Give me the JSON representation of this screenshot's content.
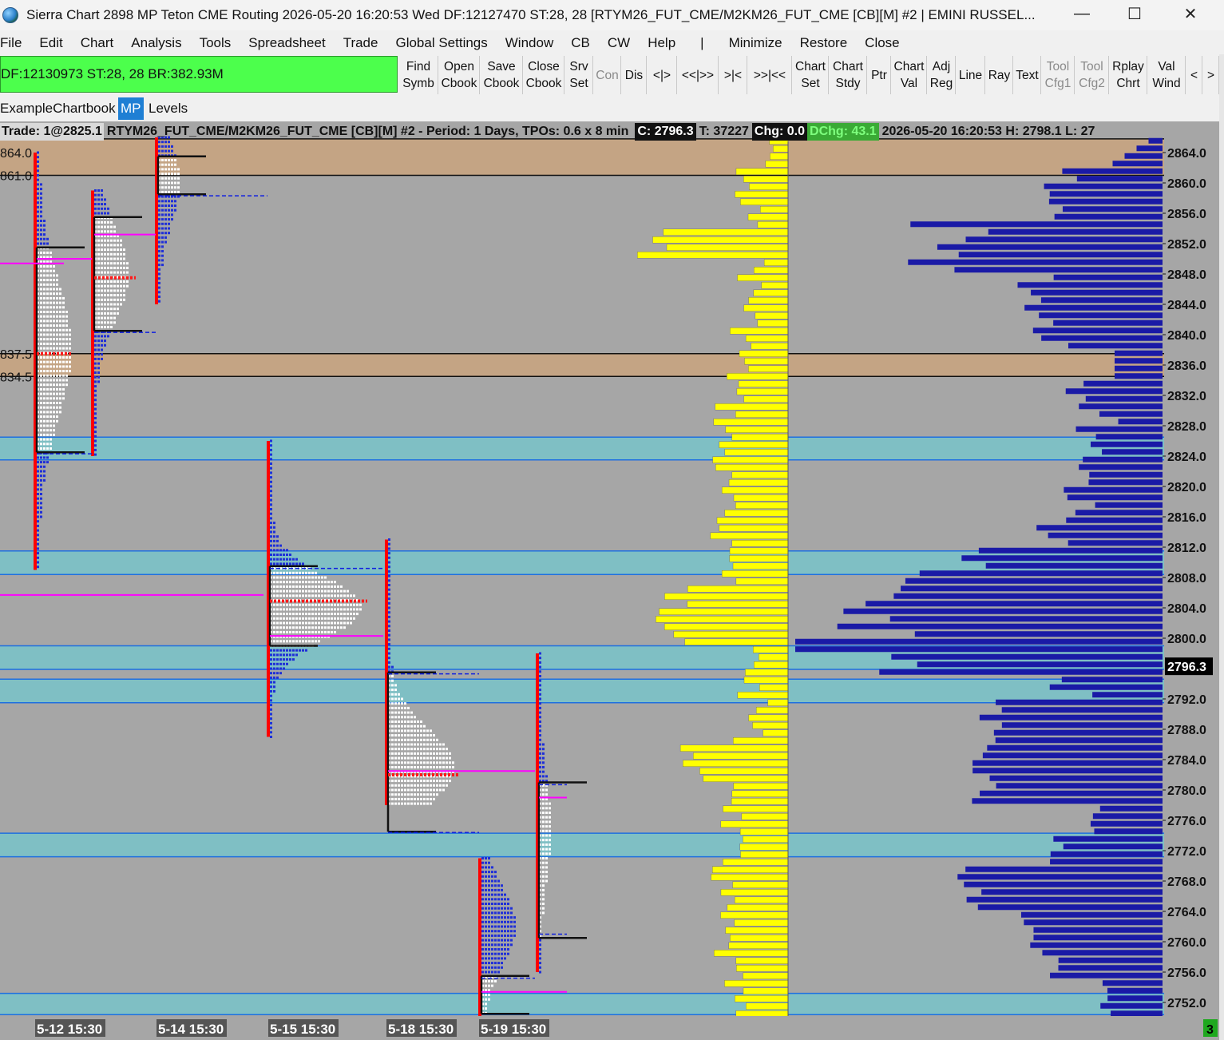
{
  "window": {
    "title": "Sierra Chart 2898 MP Teton CME Routing 2026-05-20  16:20:53 Wed DF:12127470  ST:28, 28 [RTYM26_FUT_CME/M2KM26_FUT_CME [CB][M] #2 | EMINI RUSSEL...",
    "minimize_glyph": "—",
    "maximize_glyph": "☐",
    "close_glyph": "✕"
  },
  "menu": [
    "File",
    "Edit",
    "Chart",
    "Analysis",
    "Tools",
    "Spreadsheet",
    "Trade",
    "Global Settings",
    "Window",
    "CB",
    "CW",
    "Help",
    "|",
    "Minimize",
    "Restore",
    "Close"
  ],
  "status_bar": "DF:12130973  ST:28, 28  BR:382.93M",
  "toolbar": [
    {
      "l1": "Find",
      "l2": "Symb",
      "dim": false
    },
    {
      "l1": "Open",
      "l2": "Cbook",
      "dim": false
    },
    {
      "l1": "Save",
      "l2": "Cbook",
      "dim": false
    },
    {
      "l1": "Close",
      "l2": "Cbook",
      "dim": false
    },
    {
      "l1": "Srv",
      "l2": "Set",
      "dim": false
    },
    {
      "l1": "Con",
      "l2": "",
      "dim": true
    },
    {
      "l1": "Dis",
      "l2": "",
      "dim": false
    },
    {
      "l1": "<|>",
      "l2": "",
      "dim": false
    },
    {
      "l1": "<<|>>",
      "l2": "",
      "dim": false
    },
    {
      "l1": ">|<",
      "l2": "",
      "dim": false
    },
    {
      "l1": ">>|<<",
      "l2": "",
      "dim": false
    },
    {
      "l1": "Chart",
      "l2": "Set",
      "dim": false
    },
    {
      "l1": "Chart",
      "l2": "Stdy",
      "dim": false
    },
    {
      "l1": "Ptr",
      "l2": "",
      "dim": false
    },
    {
      "l1": "Chart",
      "l2": "Val",
      "dim": false
    },
    {
      "l1": "Adj",
      "l2": "Reg",
      "dim": false
    },
    {
      "l1": "Line",
      "l2": "",
      "dim": false
    },
    {
      "l1": "Ray",
      "l2": "",
      "dim": false
    },
    {
      "l1": "Text",
      "l2": "",
      "dim": false
    },
    {
      "l1": "Tool",
      "l2": "Cfg1",
      "dim": true
    },
    {
      "l1": "Tool",
      "l2": "Cfg2",
      "dim": true
    },
    {
      "l1": "Rplay",
      "l2": "Chrt",
      "dim": false
    },
    {
      "l1": "Val",
      "l2": "Wind",
      "dim": false
    },
    {
      "l1": "<",
      "l2": "",
      "dim": false
    },
    {
      "l1": ">",
      "l2": "",
      "dim": false
    }
  ],
  "tabs": {
    "chartbook": "ExampleChartbook",
    "mp": "MP",
    "levels": "Levels"
  },
  "chart_header": {
    "trade": "Trade: 1@2825.1",
    "symbol": "RTYM26_FUT_CME/M2KM26_FUT_CME [CB][M] #2 - Period: 1 Days, TPOs: 0.6 x 8 min",
    "close": "C: 2796.3",
    "ticks": "T: 37227",
    "chg": "Chg: 0.0",
    "dchg": "DChg: 43.1",
    "datetime": "2026-05-20 16:20:53 H: 2798.1 L: 27"
  },
  "price_axis": [
    "2864.0",
    "2860.0",
    "2856.0",
    "2852.0",
    "2848.0",
    "2844.0",
    "2840.0",
    "2836.0",
    "2832.0",
    "2828.0",
    "2824.0",
    "2820.0",
    "2816.0",
    "2812.0",
    "2808.0",
    "2804.0",
    "2800.0",
    "2796.3",
    "2792.0",
    "2788.0",
    "2784.0",
    "2780.0",
    "2776.0",
    "2772.0",
    "2768.0",
    "2764.0",
    "2760.0",
    "2756.0",
    "2752.0"
  ],
  "left_level_labels": [
    "864.0",
    "861.0",
    "837.5",
    "834.5"
  ],
  "date_labels": [
    "5-12 15:30",
    "5-14 15:30",
    "5-15 15:30",
    "5-18 15:30",
    "5-19 15:30"
  ],
  "corner_badge": "3",
  "colors": {
    "chart_bg": "#a6a6a6",
    "tan_band": "#c4a484",
    "teal_band": "#7fbfc4",
    "yellow_profile": "#ffff00",
    "blue_profile": "#1a1aa6",
    "tpo_red": "#ff0000",
    "poc_magenta": "#ff00ff"
  }
}
